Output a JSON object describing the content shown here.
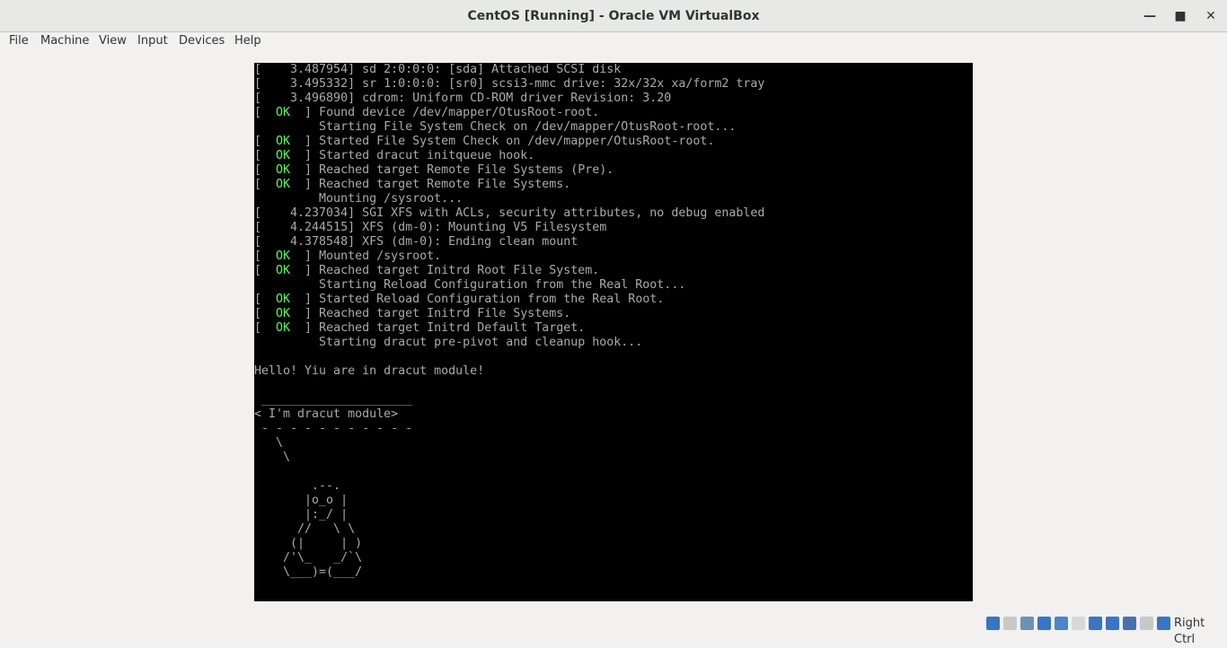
{
  "window": {
    "title": "CentOS [Running] - Oracle VM VirtualBox",
    "minimize_icon": "minimize-icon",
    "maximize_icon": "maximize-icon",
    "close_icon": "close-icon"
  },
  "menu": {
    "file": "File",
    "machine": "Machine",
    "view": "View",
    "input": "Input",
    "devices": "Devices",
    "help": "Help"
  },
  "console": {
    "lines": [
      {
        "text": "[    3.487954] sd 2:0:0:0: [sda] Attached SCSI disk"
      },
      {
        "text": "[    3.495332] sr 1:0:0:0: [sr0] scsi3-mmc drive: 32x/32x xa/form2 tray"
      },
      {
        "text": "[    3.496890] cdrom: Uniform CD-ROM driver Revision: 3.20"
      },
      {
        "ok": true,
        "text": "Found device /dev/mapper/OtusRoot-root."
      },
      {
        "text": "         Starting File System Check on /dev/mapper/OtusRoot-root..."
      },
      {
        "ok": true,
        "text": "Started File System Check on /dev/mapper/OtusRoot-root."
      },
      {
        "ok": true,
        "text": "Started dracut initqueue hook."
      },
      {
        "ok": true,
        "text": "Reached target Remote File Systems (Pre)."
      },
      {
        "ok": true,
        "text": "Reached target Remote File Systems."
      },
      {
        "text": "         Mounting /sysroot..."
      },
      {
        "text": "[    4.237034] SGI XFS with ACLs, security attributes, no debug enabled"
      },
      {
        "text": "[    4.244515] XFS (dm-0): Mounting V5 Filesystem"
      },
      {
        "text": "[    4.378548] XFS (dm-0): Ending clean mount"
      },
      {
        "ok": true,
        "text": "Mounted /sysroot."
      },
      {
        "ok": true,
        "text": "Reached target Initrd Root File System."
      },
      {
        "text": "         Starting Reload Configuration from the Real Root..."
      },
      {
        "ok": true,
        "text": "Started Reload Configuration from the Real Root."
      },
      {
        "ok": true,
        "text": "Reached target Initrd File Systems."
      },
      {
        "ok": true,
        "text": "Reached target Initrd Default Target."
      },
      {
        "text": "         Starting dracut pre-pivot and cleanup hook..."
      },
      {
        "text": ""
      },
      {
        "text": "Hello! Yiu are in dracut module!"
      },
      {
        "text": ""
      },
      {
        "text": " _____________________"
      },
      {
        "text": "< I'm dracut module>"
      },
      {
        "text": " - - - - - - - - - - -"
      },
      {
        "text": "   \\"
      },
      {
        "text": "    \\"
      },
      {
        "text": ""
      },
      {
        "text": "        .--."
      },
      {
        "text": "       |o_o |"
      },
      {
        "text": "       |:_/ |"
      },
      {
        "text": "      //   \\ \\"
      },
      {
        "text": "     (|     | )"
      },
      {
        "text": "    /'\\_   _/`\\"
      },
      {
        "text": "    \\___)=(___/"
      }
    ]
  },
  "statusbar": {
    "icons": [
      {
        "name": "hard-disk-icon",
        "color": "#3a74c4"
      },
      {
        "name": "optical-drive-icon",
        "color": "#c8c8c8"
      },
      {
        "name": "audio-icon",
        "color": "#6f8fb5"
      },
      {
        "name": "network-icon",
        "color": "#3a74c4"
      },
      {
        "name": "usb-icon",
        "color": "#4a86c8"
      },
      {
        "name": "shared-folders-icon",
        "color": "#d8d8d8"
      },
      {
        "name": "display-icon",
        "color": "#3a74c4"
      },
      {
        "name": "video-capture-icon",
        "color": "#3a74c4"
      },
      {
        "name": "virtualization-icon",
        "color": "#4a6fb0"
      },
      {
        "name": "mouse-integration-icon",
        "color": "#c8c8c8"
      },
      {
        "name": "keyboard-capture-icon",
        "color": "#3a74c4"
      }
    ],
    "host_key": "Right Ctrl"
  }
}
